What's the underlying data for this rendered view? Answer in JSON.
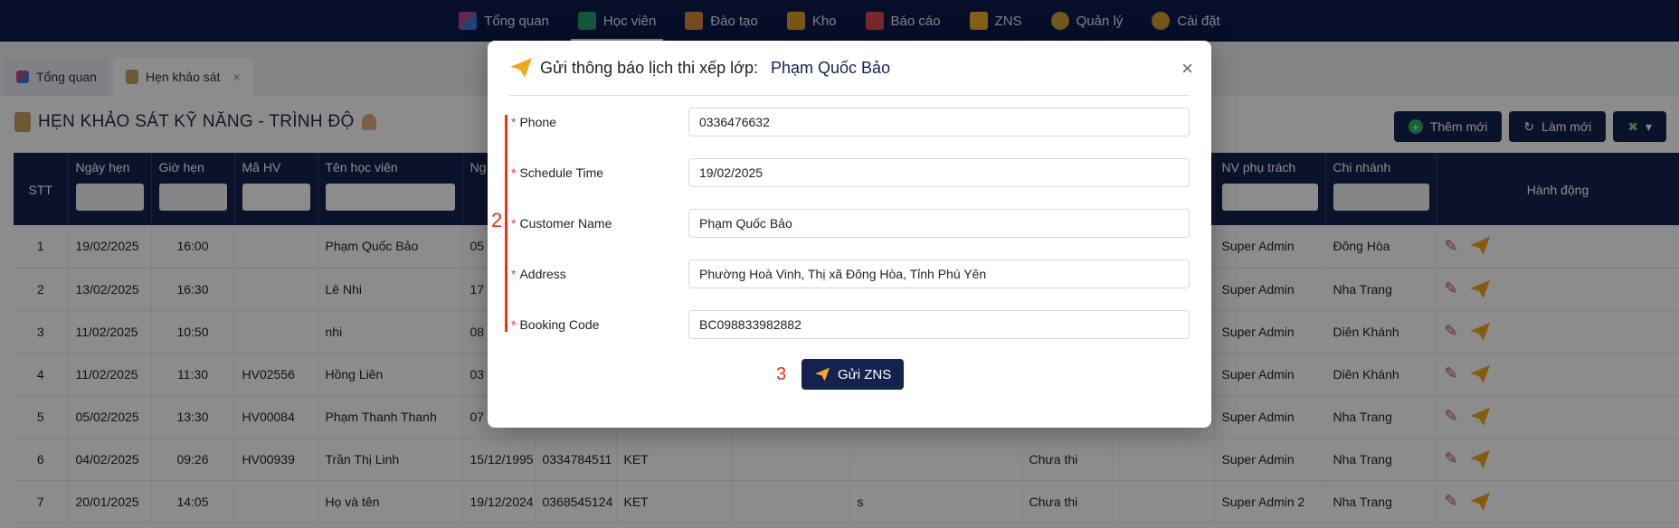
{
  "nav": {
    "items": [
      {
        "label": "Tổng quan",
        "icon": "dashboard-icon",
        "color": "#c0458a"
      },
      {
        "label": "Học viên",
        "icon": "graduation-cap-icon",
        "color": "#22a06b"
      },
      {
        "label": "Đào tạo",
        "icon": "pen-icon",
        "color": "#d98a3a"
      },
      {
        "label": "Kho",
        "icon": "box-icon",
        "color": "#e0a020"
      },
      {
        "label": "Báo cáo",
        "icon": "bar-chart-icon",
        "color": "#d94a4a"
      },
      {
        "label": "ZNS",
        "icon": "mail-icon",
        "color": "#f0b030"
      },
      {
        "label": "Quản lý",
        "icon": "gear-icon",
        "color": "#d0a030"
      },
      {
        "label": "Cài đặt",
        "icon": "settings-icon",
        "color": "#d0a030"
      }
    ],
    "active_index": 1
  },
  "tabs": [
    {
      "label": "Tổng quan",
      "icon": "dashboard-icon"
    },
    {
      "label": "Hẹn khảo sát",
      "icon": "clipboard-icon",
      "close": "×"
    }
  ],
  "page": {
    "title": "HẸN KHẢO SÁT KỸ NĂNG - TRÌNH ĐỘ",
    "buttons": {
      "add": "Thêm mới",
      "refresh": "Làm mới"
    }
  },
  "table": {
    "headers": [
      "STT",
      "Ngày hẹn",
      "Giờ hẹn",
      "Mã HV",
      "Tên học viên",
      "Ng",
      "",
      "",
      "",
      "",
      "",
      "",
      "NV phụ trách",
      "Chi nhánh",
      "Hành động"
    ],
    "rows": [
      [
        "1",
        "19/02/2025",
        "16:00",
        "",
        "Phạm Quốc Bảo",
        "05",
        "",
        "",
        "",
        "",
        "",
        "",
        "Super Admin",
        "Đông Hòa"
      ],
      [
        "2",
        "13/02/2025",
        "16:30",
        "",
        "Lê Nhi",
        "17",
        "",
        "",
        "",
        "",
        "",
        "",
        "Super Admin",
        "Nha Trang"
      ],
      [
        "3",
        "11/02/2025",
        "10:50",
        "",
        "nhi",
        "08",
        "",
        "",
        "",
        "",
        "",
        "",
        "Super Admin",
        "Diên Khánh"
      ],
      [
        "4",
        "11/02/2025",
        "11:30",
        "HV02556",
        "Hồng Liên",
        "03",
        "",
        "",
        "",
        "",
        "",
        "",
        "Super Admin",
        "Diên Khánh"
      ],
      [
        "5",
        "05/02/2025",
        "13:30",
        "HV00084",
        "Phạm Thanh Thanh",
        "07",
        "",
        "",
        "",
        "",
        "",
        "",
        "Super Admin",
        "Nha Trang"
      ],
      [
        "6",
        "04/02/2025",
        "09:26",
        "HV00939",
        "Trần Thị Linh",
        "15/12/1995",
        "0334784511",
        "KET",
        "",
        "",
        "Chưa thi",
        "",
        "Super Admin",
        "Nha Trang"
      ],
      [
        "7",
        "20/01/2025",
        "14:05",
        "",
        "Họ và tên",
        "19/12/2024",
        "0368545124",
        "KET",
        "",
        "s",
        "Chưa thi",
        "",
        "Super Admin 2",
        "Nha Trang"
      ]
    ]
  },
  "modal": {
    "title": "Gửi thông báo lịch thi xếp lớp:",
    "student_name": "Phạm Quốc Bảo",
    "close": "×",
    "fields": [
      {
        "label": "Phone",
        "value": "0336476632"
      },
      {
        "label": "Schedule Time",
        "value": "19/02/2025"
      },
      {
        "label": "Customer Name",
        "value": "Phạm Quốc Bảo"
      },
      {
        "label": "Address",
        "value": "Phường Hoà Vinh, Thị xã Đông Hòa, Tỉnh Phú Yên"
      },
      {
        "label": "Booking Code",
        "value": "BC098833982882"
      }
    ],
    "required_mark": "*",
    "send_label": "Gửi ZNS",
    "annotation_2": "2",
    "annotation_3": "3"
  },
  "colors": {
    "navy": "#14224f",
    "accent_red": "#e31"
  }
}
